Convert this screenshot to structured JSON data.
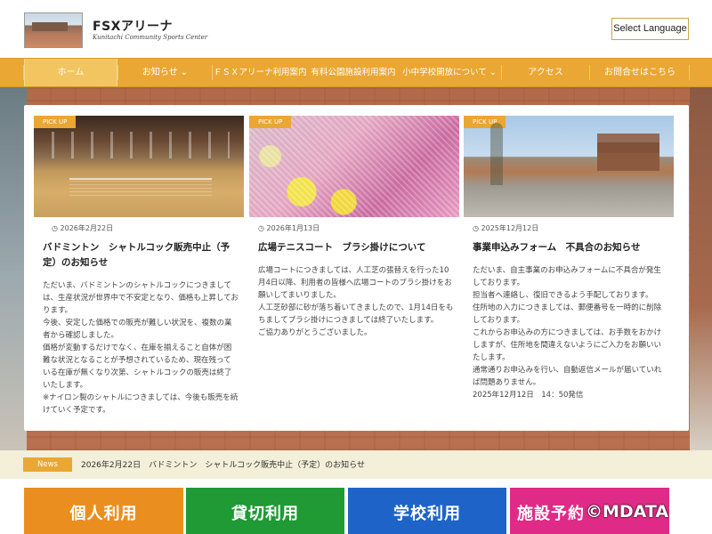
{
  "header": {
    "title": "FSXアリーナ",
    "subtitle": "Kunitachi Community Sports Center",
    "language_button": "Select Language"
  },
  "nav": {
    "items": [
      {
        "label": "ホーム",
        "active": true
      },
      {
        "label": "お知らせ ⌄"
      },
      {
        "label": "ＦＳＸアリーナ利用案内"
      },
      {
        "label": "有料公園施設利用案内"
      },
      {
        "label": "小中学校開放について ⌄"
      },
      {
        "label": "アクセス"
      },
      {
        "label": "お問合せはこちら"
      }
    ]
  },
  "cards": [
    {
      "badge": "PICK UP",
      "date": "◷ 2026年2月22日",
      "title": "バドミントン　シャトルコック販売中止（予定）のお知らせ",
      "body": [
        "ただいま、バドミントンのシャトルコックにつきましては、生産状況が世界中で不安定となり、価格も上昇しております。",
        "今後、安定した価格での販売が難しい状況を、複数の業者から確認しました。",
        "価格が変動するだけでなく、在庫を揃えること自体が困難な状況となることが予想されているため、現在残っている在庫が無くなり次第、シャトルコックの販売は終了いたします。",
        "※ナイロン製のシャトルにつきましては、今後も販売を続けていく予定です。"
      ]
    },
    {
      "badge": "PICK UP",
      "date": "◷ 2026年1月13日",
      "title": "広場テニスコート　ブラシ掛けについて",
      "body": [
        "広場コートにつきましては、人工芝の張替えを行った10月4日以降、利用者の皆様へ広場コートのブラシ掛けをお願いしてまいりました。",
        "人工芝砂部に砂が落ち着いてきましたので、1月14日をもちましてブラシ掛けにつきましては終了いたします。",
        "ご協力ありがとうございました。"
      ]
    },
    {
      "badge": "PICK UP",
      "date": "◷ 2025年12月12日",
      "title": "事業申込みフォーム　不具合のお知らせ",
      "body": [
        "ただいま、自主事業のお申込みフォームに不具合が発生しております。",
        "担当者へ連絡し、復旧できるよう手配しております。",
        "住所地の入力につきましては、郵便番号を一時的に削除しております。",
        "これからお申込みの方につきましては、お手数をおかけしますが、住所地を間違えないようにご入力をお願いいたします。",
        "通常通りお申込みを行い、自動返信メールが届いていれば問題ありません。",
        "2025年12月12日　14：50発信"
      ]
    }
  ],
  "news": {
    "label": "News",
    "text": "2026年2月22日　バドミントン　シャトルコック販売中止（予定）のお知らせ"
  },
  "bottom_buttons": [
    {
      "label": "個人利用",
      "color": "#ea8f1f"
    },
    {
      "label": "貸切利用",
      "color": "#1f9a35"
    },
    {
      "label": "学校利用",
      "color": "#1e64c8"
    },
    {
      "label": "施設予約",
      "color": "#e02a87"
    }
  ],
  "watermark": "©MDATA",
  "colors": {
    "accent": "#eaa733",
    "news_bg": "#f3efd9"
  }
}
